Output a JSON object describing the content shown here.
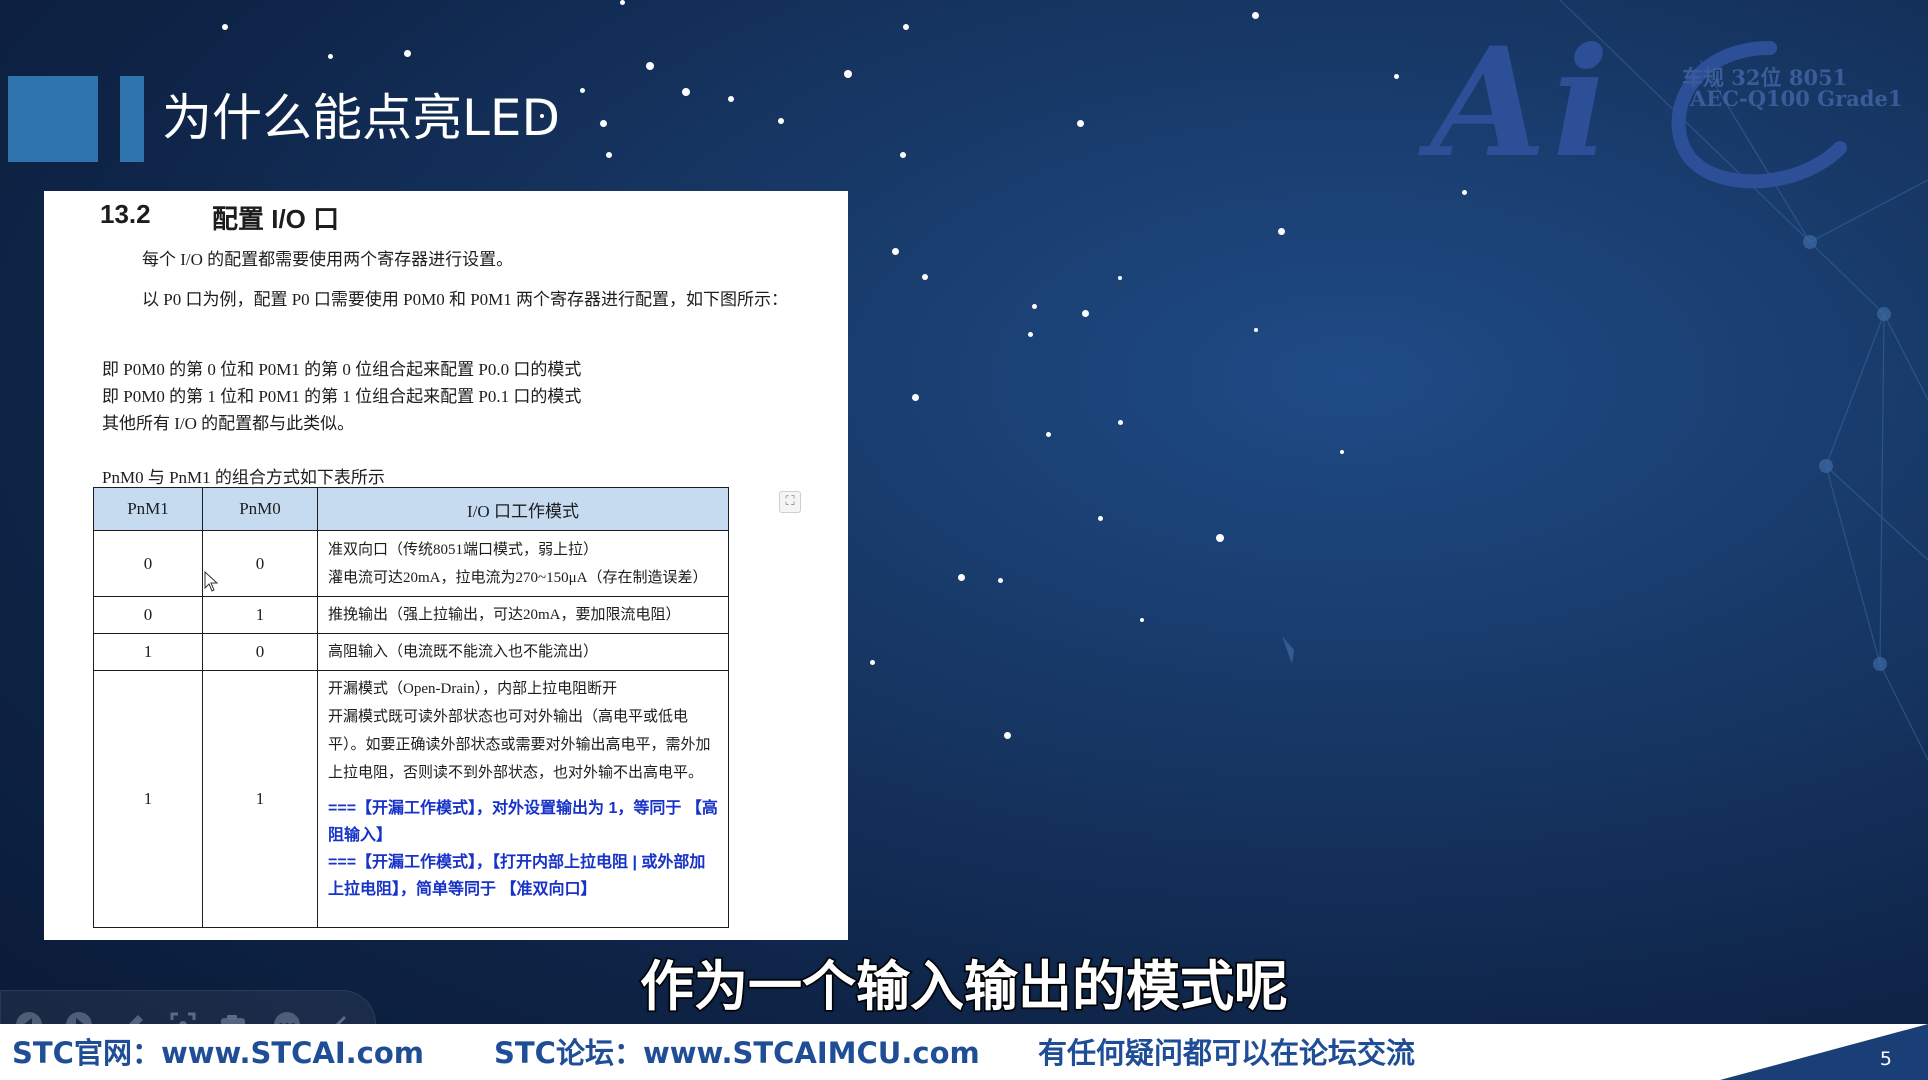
{
  "slide": {
    "title": "为什么能点亮LED",
    "page_number": "5"
  },
  "logo": {
    "mark": "Ai",
    "line1": "车规 32位 8051",
    "line2": "AEC-Q100 Grade1"
  },
  "document": {
    "section_number": "13.2",
    "section_title": "配置 I/O 口",
    "paragraphs": [
      "每个 I/O 的配置都需要使用两个寄存器进行设置。",
      "以 P0 口为例，配置 P0 口需要使用 P0M0 和 P0M1 两个寄存器进行配置，如下图所示：",
      "即 P0M0 的第 0 位和 P0M1 的第 0 位组合起来配置 P0.0 口的模式",
      "即 P0M0 的第 1 位和 P0M1 的第 1 位组合起来配置 P0.1 口的模式",
      "其他所有 I/O 的配置都与此类似。",
      "PnM0 与 PnM1 的组合方式如下表所示"
    ],
    "table": {
      "headers": [
        "PnM1",
        "PnM0",
        "I/O 口工作模式"
      ],
      "rows": [
        {
          "pnm1": "0",
          "pnm0": "0",
          "lines": [
            "准双向口（传统8051端口模式，弱上拉）",
            "灌电流可达20mA，拉电流为270~150μA（存在制造误差）"
          ]
        },
        {
          "pnm1": "0",
          "pnm0": "1",
          "lines": [
            "推挽输出（强上拉输出，可达20mA，要加限流电阻）"
          ]
        },
        {
          "pnm1": "1",
          "pnm0": "0",
          "lines": [
            "高阻输入（电流既不能流入也不能流出）"
          ]
        },
        {
          "pnm1": "1",
          "pnm0": "1",
          "lines": [
            "开漏模式（Open-Drain），内部上拉电阻断开",
            "开漏模式既可读外部状态也可对外输出（高电平或低电平）。如要正确读外部状态或需要对外输出高电平，需外加上拉电阻，否则读不到外部状态，也对外输不出高电平。"
          ],
          "notes": [
            "===【开漏工作模式】，对外设置输出为 1，等同于 【高阻输入】",
            "===【开漏工作模式】，【打开内部上拉电阻 | 或外部加上拉电阻】，简单等同于 【准双向口】"
          ]
        }
      ]
    }
  },
  "subtitle": "作为一个输入输出的模式呢",
  "footer": {
    "site": "STC官网：www.STCAI.com",
    "forum": "STC论坛：www.STCAIMCU.com",
    "note": "有任何疑问都可以在论坛交流"
  },
  "toolbar": {
    "icons": [
      "prev-icon",
      "next-icon",
      "pen-icon",
      "screen-capture-icon",
      "camera-icon",
      "more-icon",
      "collapse-icon"
    ]
  },
  "colors": {
    "background": "#173866",
    "accent": "#2f74ad",
    "footer_text": "#1f4e96",
    "table_header": "#c6daf0",
    "note_blue": "#1632c8"
  }
}
